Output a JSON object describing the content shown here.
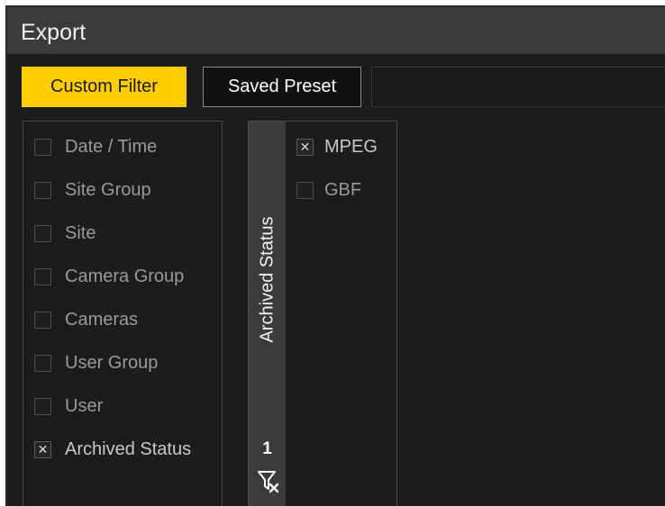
{
  "window": {
    "title": "Export"
  },
  "tabs": [
    {
      "label": "Custom Filter",
      "active": true
    },
    {
      "label": "Saved Preset",
      "active": false
    }
  ],
  "filters": [
    {
      "label": "Date / Time",
      "checked": false
    },
    {
      "label": "Site Group",
      "checked": false
    },
    {
      "label": "Site",
      "checked": false
    },
    {
      "label": "Camera Group",
      "checked": false
    },
    {
      "label": "Cameras",
      "checked": false
    },
    {
      "label": "User Group",
      "checked": false
    },
    {
      "label": "User",
      "checked": false
    },
    {
      "label": "Archived Status",
      "checked": true
    }
  ],
  "archived_status_panel": {
    "title": "Archived Status",
    "selected_count": "1",
    "clear_icon": "filter-clear-icon",
    "options": [
      {
        "label": "MPEG",
        "checked": true
      },
      {
        "label": "GBF",
        "checked": false
      }
    ]
  },
  "colors": {
    "accent": "#ffcc00",
    "background": "#1c1c1c",
    "title_bar": "#3b3b3b"
  }
}
